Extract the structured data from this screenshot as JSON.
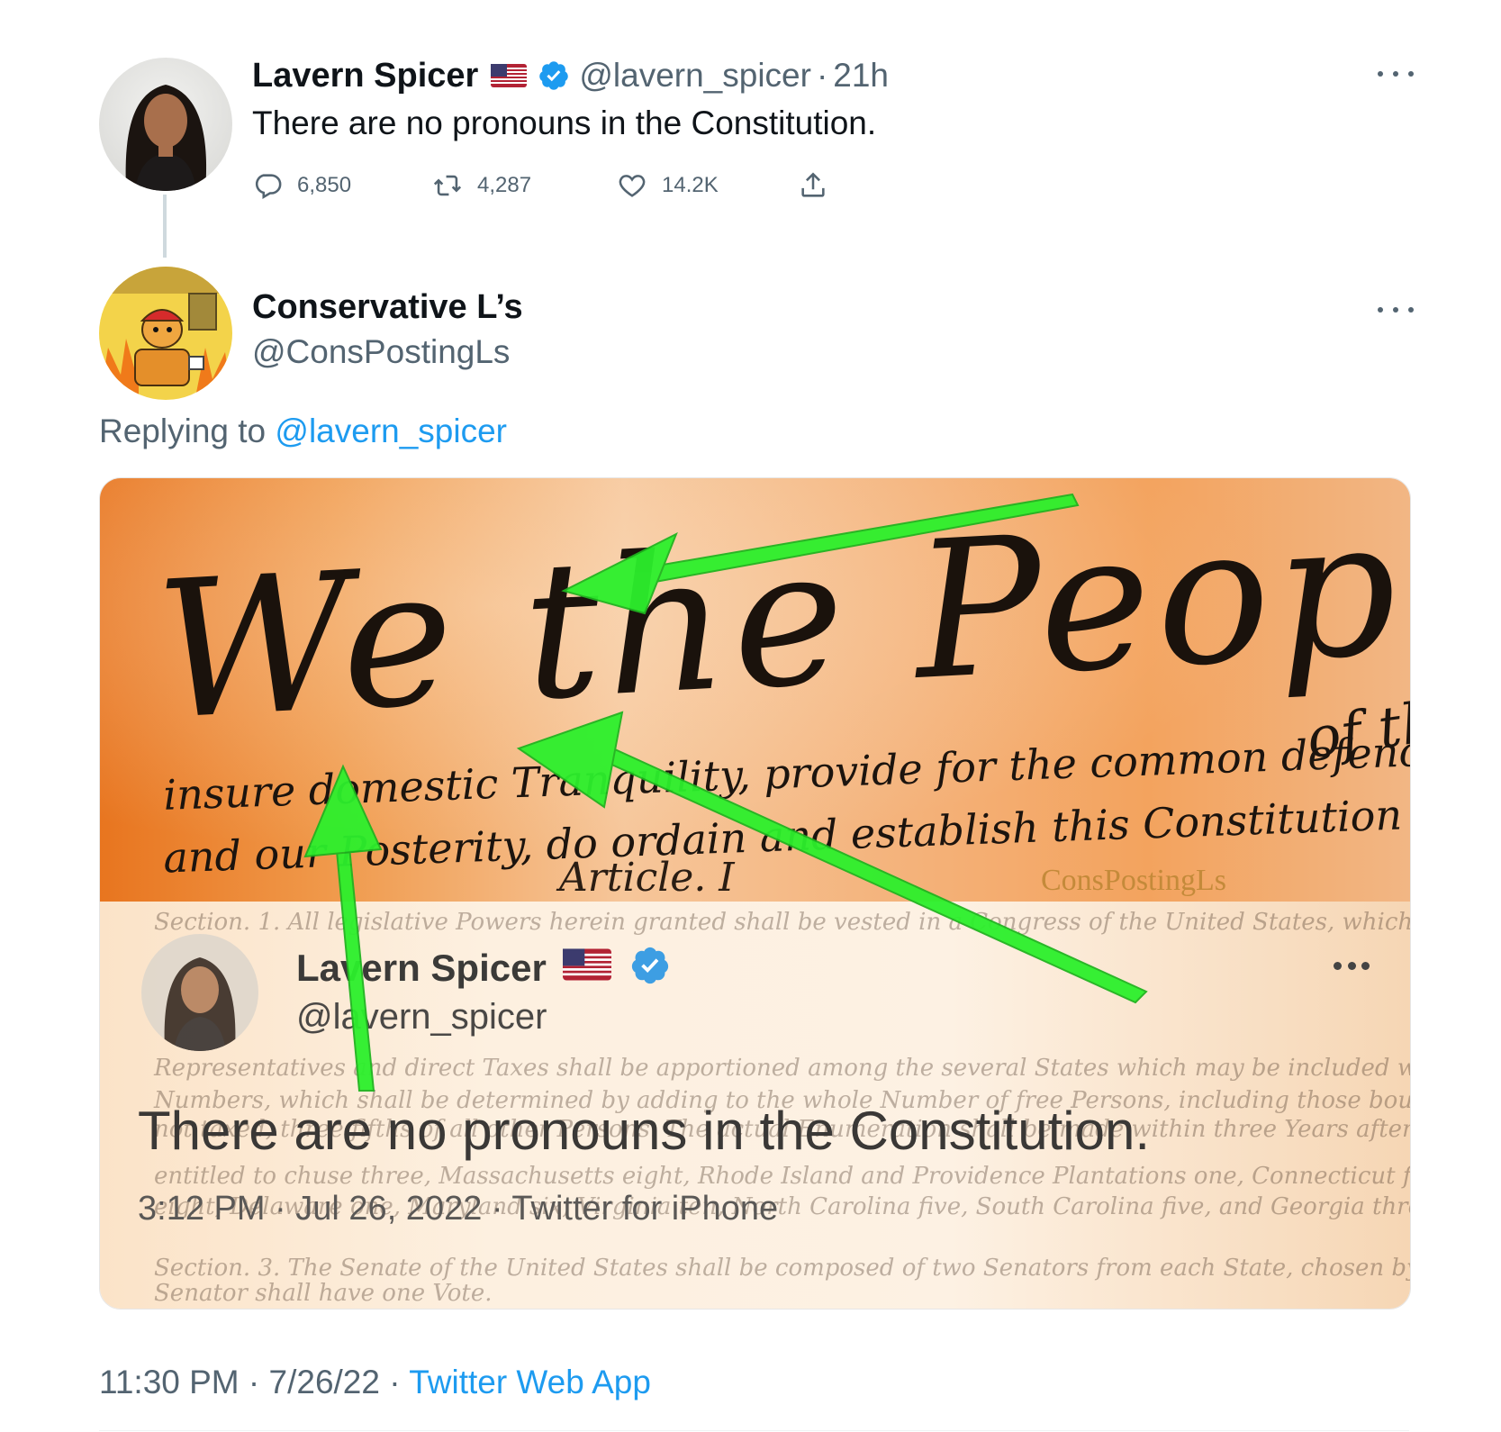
{
  "parent_tweet": {
    "display_name": "Lavern Spicer",
    "flag_icon": "us-flag-icon",
    "verified_icon": "verified-badge-icon",
    "handle": "@lavern_spicer",
    "separator": "·",
    "time": "21h",
    "text": "There are no pronouns in the Constitution.",
    "actions": {
      "reply_count": "6,850",
      "retweet_count": "4,287",
      "like_count": "14.2K"
    }
  },
  "reply_tweet": {
    "display_name": "Conservative L’s",
    "handle": "@ConsPostingLs",
    "replying_prefix": "Replying to",
    "replying_to": "@lavern_spicer",
    "media": {
      "headline": "We the People",
      "preamble_line_1": "insure domestic Tranquility, provide for the common defence",
      "preamble_line_2": "and our Posterity, do ordain and establish this Constitution f",
      "preamble_of": "of the",
      "article_label": "Article. I",
      "watermark": "ConsPostingLs",
      "embedded_tweet": {
        "display_name": "Lavern Spicer",
        "handle": "@lavern_spicer",
        "text": "There are no pronouns in the Constitution.",
        "meta": "3:12 PM · Jul 26, 2022 · Twitter for iPhone"
      },
      "arrow_color": "#2cf02c"
    },
    "timestamp": "11:30 PM · 7/26/22 ·",
    "source_app": "Twitter Web App"
  },
  "colors": {
    "link": "#1d9bf0",
    "secondary_text": "#536471",
    "primary_text": "#0f1419",
    "verified": "#1d9bf0"
  }
}
